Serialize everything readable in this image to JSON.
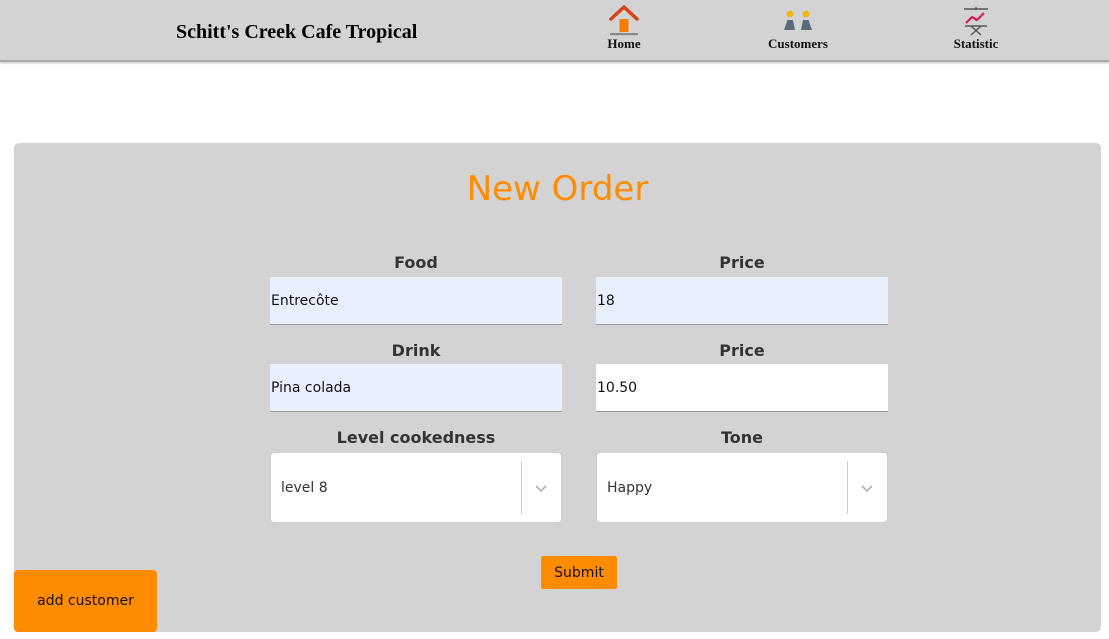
{
  "header": {
    "brand": "Schitt's Creek Cafe Tropical",
    "nav": [
      {
        "label": "Home",
        "icon": "home-icon"
      },
      {
        "label": "Customers",
        "icon": "customers-icon"
      },
      {
        "label": "Statistic",
        "icon": "statistic-icon"
      }
    ]
  },
  "form": {
    "title": "New Order",
    "food_label": "Food",
    "food_value": "Entrecôte",
    "food_price_label": "Price",
    "food_price_value": "18",
    "drink_label": "Drink",
    "drink_value": "Pina colada",
    "drink_price_label": "Price",
    "drink_price_value": "10.50",
    "cookedness_label": "Level cookedness",
    "cookedness_value": "level 8",
    "tone_label": "Tone",
    "tone_value": "Happy",
    "submit_label": "Submit"
  },
  "add_customer_label": "add customer",
  "colors": {
    "accent": "#ff8c00",
    "panel": "#d3d3d3",
    "autofill": "#e8f0fe"
  }
}
